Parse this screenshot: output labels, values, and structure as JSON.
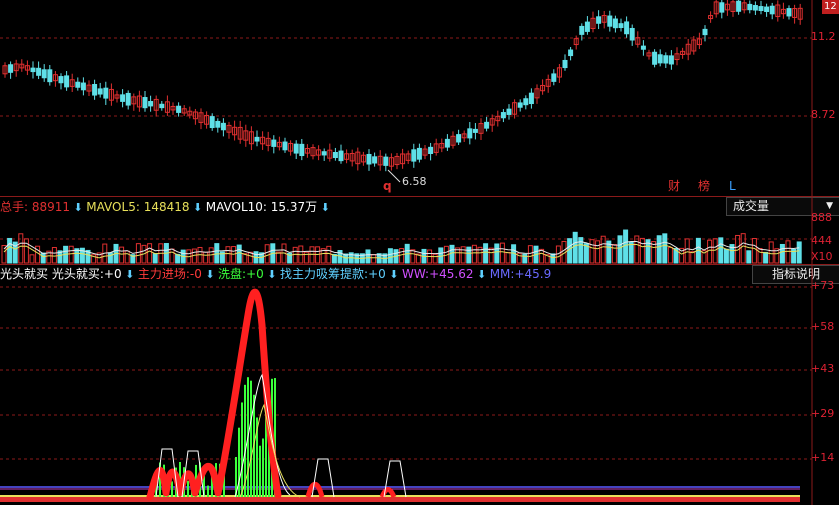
{
  "price_pane": {
    "axis_labels": [
      "11.2",
      "8.72"
    ],
    "low_marker": "6.58",
    "q_marker": "q",
    "badges": [
      {
        "text": "财",
        "color": "#e03030"
      },
      {
        "text": "榜",
        "color": "#e03030"
      },
      {
        "text": "L",
        "color": "#3aa0ff"
      }
    ],
    "top_right_label": "12"
  },
  "volume_pane": {
    "stats": [
      {
        "label": "总手: ",
        "value": "88911",
        "color": "#e03030"
      },
      {
        "label": "MAVOL5: ",
        "value": "148418",
        "color": "#e8e05a"
      },
      {
        "label": "MAVOL10: ",
        "value": "15.37万",
        "color": "#ffffff"
      }
    ],
    "dropdown_label": "成交量",
    "axis_labels": [
      "888",
      "444",
      "X10"
    ]
  },
  "indicator_pane": {
    "legend": [
      {
        "label": "光头就买",
        "value": "",
        "color": "#ffffff"
      },
      {
        "label": "光头就买:",
        "value": "+0",
        "color": "#ffffff"
      },
      {
        "label": "主力进场:",
        "value": "-0",
        "color": "#ff3b3b"
      },
      {
        "label": "洗盘:",
        "value": "+0",
        "color": "#3bff3b"
      },
      {
        "label": "找主力吸筹提款:",
        "value": "+0",
        "color": "#5fd0ff"
      },
      {
        "label": "WW:",
        "value": "+45.62",
        "color": "#d050ff"
      },
      {
        "label": "MM:",
        "value": "+45.9",
        "color": "#6a6aff"
      }
    ],
    "help_button": "指标说明",
    "axis_labels": [
      "+73",
      "+58",
      "+43",
      "+29",
      "+14"
    ]
  },
  "colors": {
    "up": "#e03030",
    "down": "#5fe0e8",
    "grid": "#8b1a1a",
    "ma_white": "#e8e8e8",
    "ma_yellow": "#e8e05a"
  }
}
